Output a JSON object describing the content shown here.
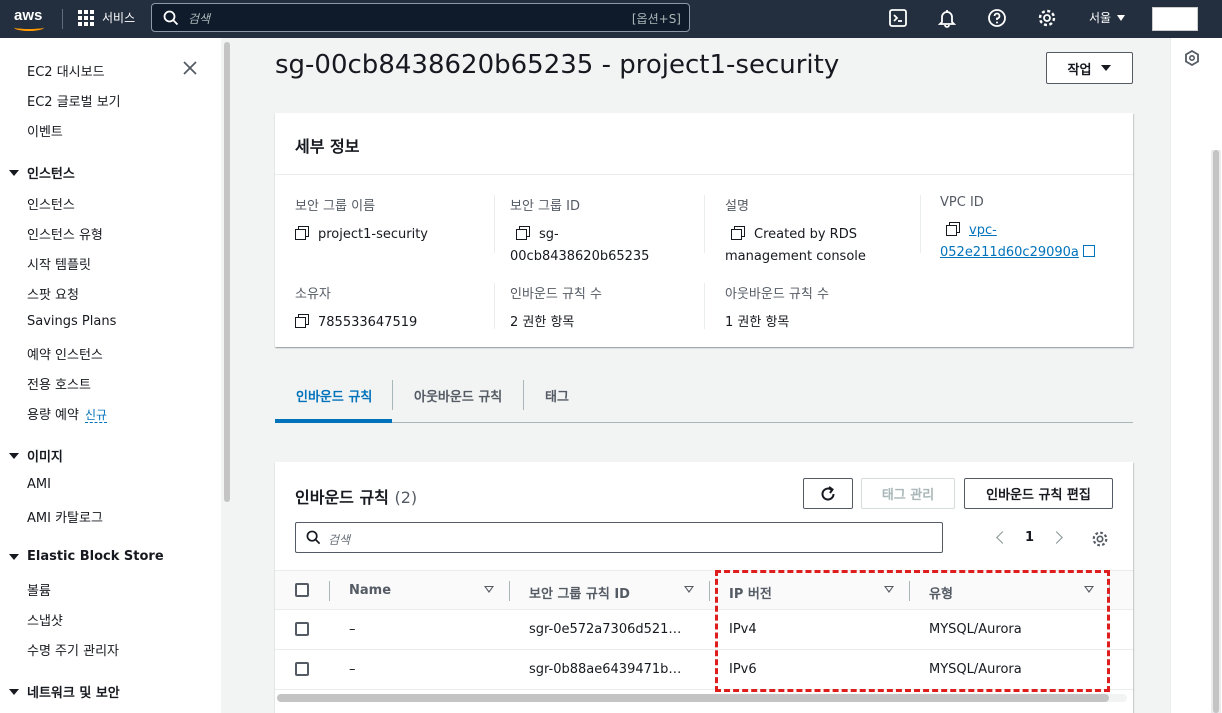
{
  "topnav": {
    "logo": "aws",
    "services_label": "서비스",
    "search_placeholder": "검색",
    "search_hint": "[옵션+S]",
    "region": "서울"
  },
  "sidebar": {
    "items_top": [
      "EC2 대시보드",
      "EC2 글로벌 보기",
      "이벤트"
    ],
    "instances_head": "인스턴스",
    "instances_items": [
      "인스턴스",
      "인스턴스 유형",
      "시작 템플릿",
      "스팟 요청",
      "Savings Plans",
      "예약 인스턴스",
      "전용 호스트",
      "용량 예약"
    ],
    "new_badge": "신규",
    "images_head": "이미지",
    "images_items": [
      "AMI",
      "AMI 카탈로그"
    ],
    "ebs_head": "Elastic Block Store",
    "ebs_items": [
      "볼륨",
      "스냅샷",
      "수명 주기 관리자"
    ],
    "network_head": "네트워크 및 보안"
  },
  "page": {
    "title": "sg-00cb8438620b65235 - project1-security",
    "actions_label": "작업"
  },
  "details": {
    "title": "세부 정보",
    "sg_name_label": "보안 그룹 이름",
    "sg_name_value": "project1-security",
    "sg_id_label": "보안 그룹 ID",
    "sg_id_value_1": "sg-",
    "sg_id_value_2": "00cb8438620b65235",
    "desc_label": "설명",
    "desc_value_1": "Created by RDS",
    "desc_value_2": "management console",
    "vpc_label": "VPC ID",
    "vpc_value_1": "vpc-",
    "vpc_value_2": "052e211d60c29090a",
    "owner_label": "소유자",
    "owner_value": "785533647519",
    "inbound_count_label": "인바운드 규칙 수",
    "inbound_count_value": "2 권한 항목",
    "outbound_count_label": "아웃바운드 규칙 수",
    "outbound_count_value": "1 권한 항목"
  },
  "tabs": [
    "인바운드 규칙",
    "아웃바운드 규칙",
    "태그"
  ],
  "rules": {
    "title": "인바운드 규칙",
    "count": "(2)",
    "tag_mgmt_label": "태그 관리",
    "edit_label": "인바운드 규칙 편집",
    "search_placeholder": "검색",
    "page_number": "1",
    "columns": [
      "Name",
      "보안 그룹 규칙 ID",
      "IP 버전",
      "유형"
    ],
    "rows": [
      {
        "name": "–",
        "rule_id": "sgr-0e572a7306d521…",
        "ip_version": "IPv4",
        "type": "MYSQL/Aurora"
      },
      {
        "name": "–",
        "rule_id": "sgr-0b88ae6439471b…",
        "ip_version": "IPv6",
        "type": "MYSQL/Aurora"
      }
    ]
  },
  "colors": {
    "nav_bg": "#232f3e",
    "accent": "#0073bb",
    "highlight": "#e01d1d",
    "logo_orange": "#ff9900"
  }
}
